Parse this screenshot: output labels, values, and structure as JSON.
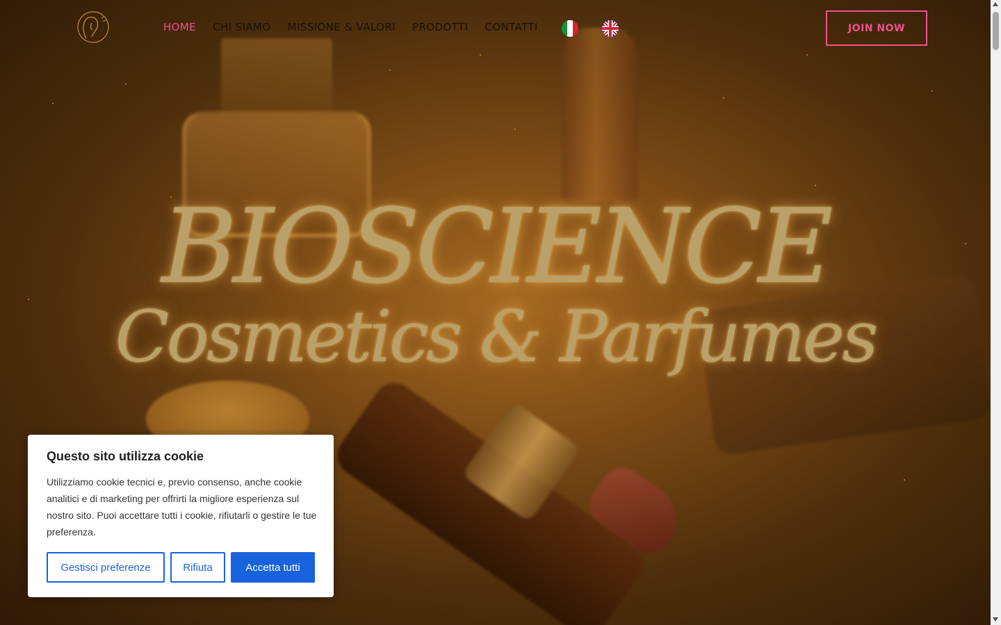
{
  "header": {
    "logo_icon": "woman-silhouette-logo-icon",
    "nav": [
      {
        "label": "HOME",
        "active": true
      },
      {
        "label": "CHI SIAMO",
        "active": false
      },
      {
        "label": "MISSIONE & VALORI",
        "active": false
      },
      {
        "label": "PRODOTTI",
        "active": false
      },
      {
        "label": "CONTATTI",
        "active": false
      }
    ],
    "languages": [
      {
        "icon": "italy-flag-icon"
      },
      {
        "icon": "uk-flag-icon"
      }
    ],
    "join_label": "JOIN NOW"
  },
  "hero": {
    "title": "BIOSCIENCE",
    "subtitle": "Cosmetics & Parfumes"
  },
  "cookie_banner": {
    "title": "Questo sito utilizza cookie",
    "text": "Utilizziamo cookie tecnici e, previo consenso, anche cookie analitici e di  marketing per offrirti la migliore esperienza sul nostro sito. Puoi accettare tutti i cookie, rifiutarli o gestire le tue preferenza.",
    "manage_label": "Gestisci preferenze",
    "reject_label": "Rifiuta",
    "accept_label": "Accetta tutti"
  },
  "colors": {
    "accent": "#f0508a",
    "cookie_button": "#1863dc",
    "title_gold": "#b9a169"
  }
}
